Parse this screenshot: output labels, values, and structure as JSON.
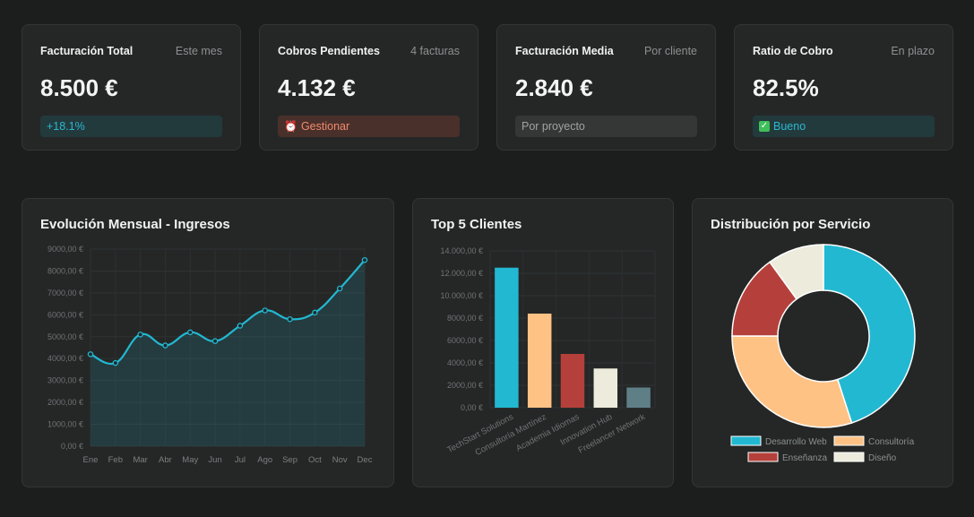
{
  "kpis": [
    {
      "title": "Facturación Total",
      "subtitle": "Este mes",
      "value": "8.500 €",
      "badge": "+18.1%",
      "badge_icon": ""
    },
    {
      "title": "Cobros Pendientes",
      "subtitle": "4 facturas",
      "value": "4.132 €",
      "badge": "Gestionar",
      "badge_icon": "⏰"
    },
    {
      "title": "Facturación Media",
      "subtitle": "Por cliente",
      "value": "2.840 €",
      "badge": "Por proyecto",
      "badge_icon": ""
    },
    {
      "title": "Ratio de Cobro",
      "subtitle": "En plazo",
      "value": "82.5%",
      "badge": "Bueno",
      "badge_icon": "✓"
    }
  ],
  "colors": {
    "accent": "#22b8d1",
    "peach": "#ffc285",
    "red": "#b5403b",
    "cream": "#ecebdc",
    "slate": "#5f7f87"
  },
  "line_chart": {
    "title": "Evolución Mensual - Ingresos",
    "chart_data": {
      "type": "area",
      "categories": [
        "Ene",
        "Feb",
        "Mar",
        "Abr",
        "May",
        "Jun",
        "Jul",
        "Ago",
        "Sep",
        "Oct",
        "Nov",
        "Dec"
      ],
      "values": [
        4200,
        3800,
        5100,
        4600,
        5200,
        4800,
        5500,
        6200,
        5800,
        6100,
        7200,
        8500
      ],
      "ylim": [
        0,
        9000
      ],
      "yticks": [
        "0,00 €",
        "1000,00 €",
        "2000,00 €",
        "3000,00 €",
        "4000,00 €",
        "5000,00 €",
        "6000,00 €",
        "7000,00 €",
        "8000,00 €",
        "9000,00 €"
      ],
      "grid": true
    }
  },
  "bar_chart": {
    "title": "Top 5 Clientes",
    "chart_data": {
      "type": "bar",
      "categories": [
        "TechStart Solutions",
        "Consultoría Martínez",
        "Academia Idiomas",
        "Innovation Hub",
        "Freelancer Network"
      ],
      "values": [
        12500,
        8400,
        4800,
        3500,
        1800
      ],
      "colors": [
        "#22b8d1",
        "#ffc285",
        "#b5403b",
        "#ecebdc",
        "#5f7f87"
      ],
      "ylim": [
        0,
        14000
      ],
      "yticks": [
        "0,00 €",
        "2000,00 €",
        "4000,00 €",
        "6000,00 €",
        "8000,00 €",
        "10.000,00 €",
        "12.000,00 €",
        "14.000,00 €"
      ],
      "grid": true
    }
  },
  "pie_chart": {
    "title": "Distribución por Servicio",
    "chart_data": {
      "type": "pie",
      "labels": [
        "Desarrollo Web",
        "Consultoría",
        "Enseñanza",
        "Diseño"
      ],
      "values": [
        45,
        30,
        15,
        10
      ],
      "colors": [
        "#22b8d1",
        "#ffc285",
        "#b5403b",
        "#ecebdc"
      ],
      "legend": "bottom"
    }
  }
}
